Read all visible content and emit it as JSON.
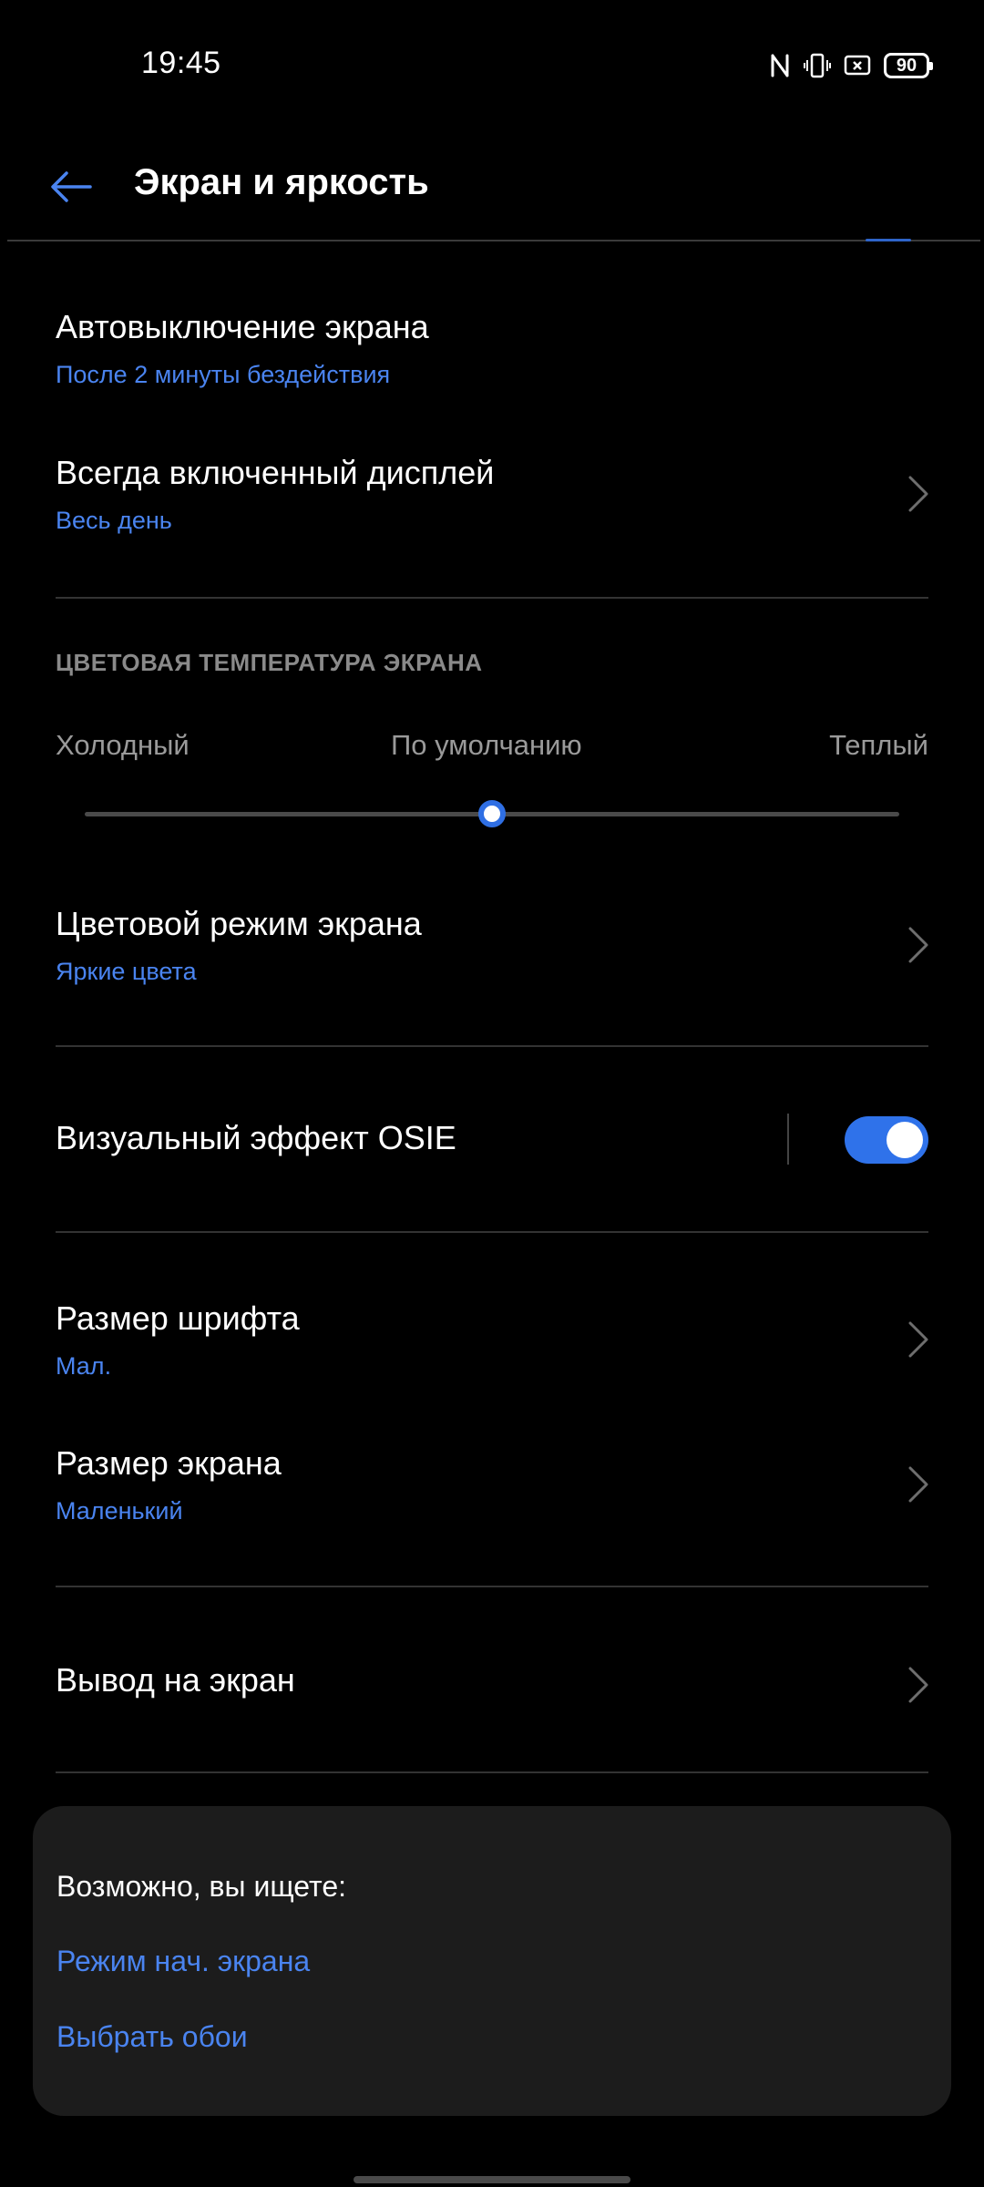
{
  "status_bar": {
    "time": "19:45",
    "icons": [
      "nfc-icon",
      "vibrate-icon",
      "screen-cast-icon",
      "battery-icon"
    ],
    "battery_level": "90"
  },
  "header": {
    "back_icon": "arrow-left-icon",
    "title": "Экран и яркость"
  },
  "settings": {
    "auto_off": {
      "title": "Автовыключение экрана",
      "value": "После 2 минуты бездействия"
    },
    "always_on": {
      "title": "Всегда включенный дисплей",
      "value": "Весь день"
    },
    "color_temp": {
      "section_label": "ЦВЕТОВАЯ ТЕМПЕРАТУРА ЭКРАНА",
      "label_cold": "Холодный",
      "label_default": "По умолчанию",
      "label_warm": "Теплый",
      "slider_fraction": 0.5
    },
    "color_mode": {
      "title": "Цветовой режим экрана",
      "value": "Яркие цвета"
    },
    "osie": {
      "title": "Визуальный эффект OSIE",
      "enabled": true
    },
    "font_size": {
      "title": "Размер шрифта",
      "value": "Мал."
    },
    "display_size": {
      "title": "Размер экрана",
      "value": "Маленький"
    },
    "cast": {
      "title": "Вывод на экран"
    }
  },
  "suggestions": {
    "title": "Возможно, вы ищете:",
    "links": [
      "Режим нач. экрана",
      "Выбрать обои"
    ]
  },
  "colors": {
    "accent": "#4a84f0",
    "toggle_on": "#2f72ea",
    "background": "#000000",
    "card": "#1c1c1c"
  }
}
